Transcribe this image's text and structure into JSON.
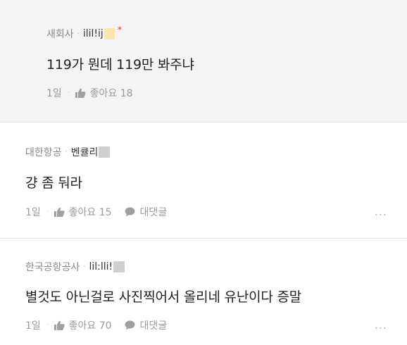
{
  "comments": [
    {
      "company": "새회사",
      "nickname": "ilil!ij",
      "text": "119가 뭔데 119만 봐주냐",
      "time": "1일",
      "like_label": "좋아요 18"
    },
    {
      "company": "대한항공",
      "nickname": "벤큘리",
      "text": "걍 좀 둬라",
      "time": "1일",
      "like_label": "좋아요 15",
      "reply_label": "대댓글"
    },
    {
      "company": "한국공항공사",
      "nickname": "lil:lli!",
      "text": "별것도 아닌걸로 사진찍어서 올리네 유난이다 증말",
      "time": "1일",
      "like_label": "좋아요 70",
      "reply_label": "대댓글"
    }
  ],
  "separator_glyph": "·",
  "more_glyph": "...",
  "colors": {
    "highlight_bg": "#f4f4f4",
    "muted_text": "#9a9a9a",
    "star_red": "#d33333"
  },
  "icons": [
    "thumbs-up-icon",
    "speech-bubble-icon",
    "more-dots-icon"
  ]
}
